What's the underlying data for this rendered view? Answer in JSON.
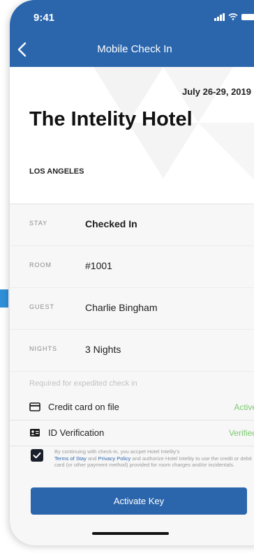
{
  "status_bar": {
    "time": "9:41"
  },
  "header": {
    "title": "Mobile Check In"
  },
  "hotel": {
    "dates": "July 26-29, 2019",
    "name": "The Intelity Hotel",
    "city": "LOS ANGELES"
  },
  "details": [
    {
      "label": "STAY",
      "value": "Checked In"
    },
    {
      "label": "ROOM",
      "value": "#1001"
    },
    {
      "label": "GUEST",
      "value": "Charlie Bingham"
    },
    {
      "label": "NIGHTS",
      "value": "3 Nights"
    }
  ],
  "requirements": {
    "heading": "Required for expedited check in",
    "items": [
      {
        "icon": "credit-card-icon",
        "label": "Credit card on file",
        "status": "Active"
      },
      {
        "icon": "id-card-icon",
        "label": "ID Verification",
        "status": "Verified"
      }
    ]
  },
  "consent": {
    "checked": true,
    "text_before": "By continuing with check-in, you accpet Hotel Intelity's",
    "terms_link": "Terms of Stay",
    "text_and": "and",
    "privacy_link": "Privacy Policy",
    "text_after": "and authorize Hotel Intelity to use the credit or debit card (or other payment method) provided for room charges and/or incidentals."
  },
  "actions": {
    "activate_label": "Activate Key"
  },
  "colors": {
    "primary": "#2b66ad",
    "status_ok": "#7bc96f",
    "checkbox": "#1a1f2b"
  }
}
